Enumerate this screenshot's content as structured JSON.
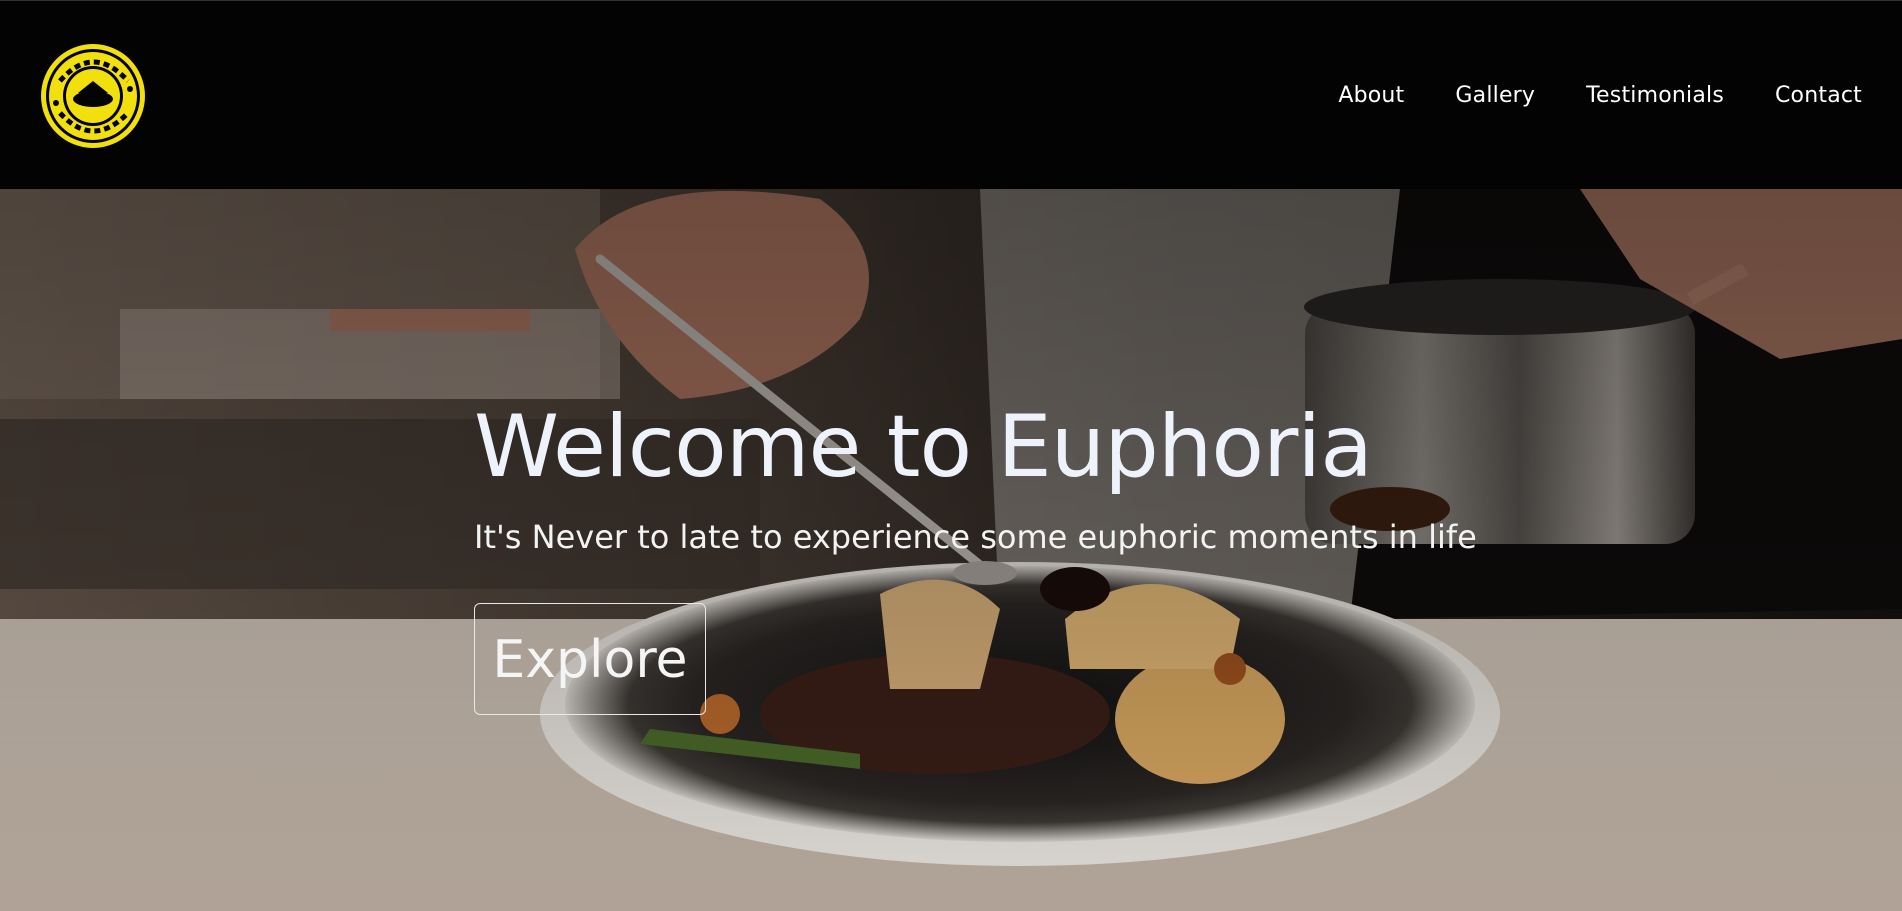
{
  "brand": {
    "logo_icon": "euphoria-round-logo-icon",
    "logo_text": "EUPHORIA",
    "logo_inner_text": "EUPHORIA",
    "logo_arc_text": "SINGAPORE",
    "accent_color": "#f1e00e"
  },
  "nav": {
    "items": [
      {
        "label": "About"
      },
      {
        "label": "Gallery"
      },
      {
        "label": "Testimonials"
      },
      {
        "label": "Contact"
      }
    ]
  },
  "hero": {
    "title": "Welcome to Euphoria",
    "subtitle": "It's Never to late to experience some euphoric moments in life",
    "button_label": "Explore",
    "image_subject": "chef-plating-dish-photo"
  },
  "colors": {
    "header_bg": "#030303",
    "text_light": "#eef2fb"
  }
}
